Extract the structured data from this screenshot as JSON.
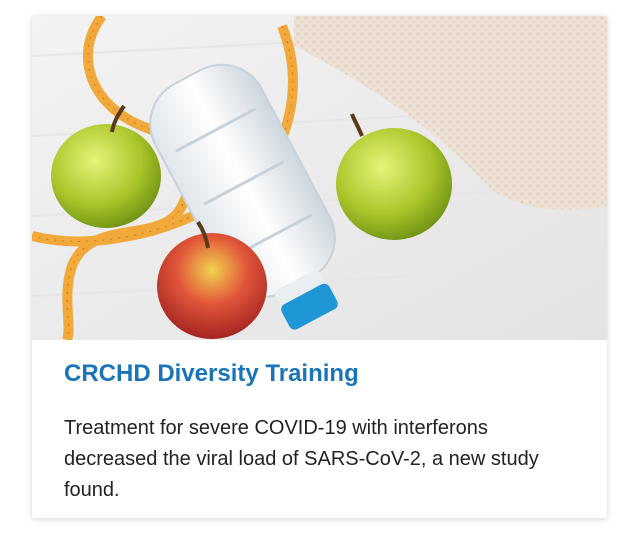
{
  "card": {
    "image_icon": "photo-icon",
    "title": "CRCHD Diversity Training",
    "description": "Treatment for severe COVID-19 with interferons decreased the viral load of SARS-CoV-2, a new study found."
  },
  "colors": {
    "title": "#1a75b8",
    "text": "#222222",
    "background": "#ffffff"
  }
}
